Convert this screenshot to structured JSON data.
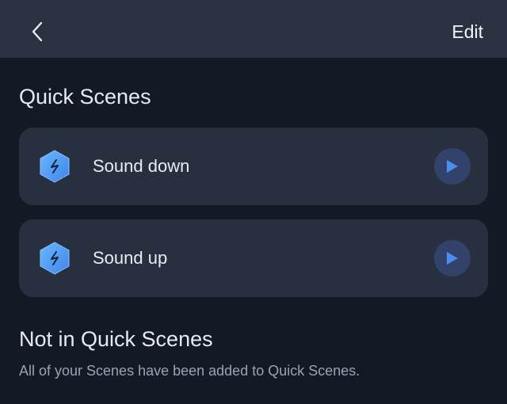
{
  "header": {
    "back_icon": "chevron-left-icon",
    "edit_label": "Edit"
  },
  "quick_scenes": {
    "title": "Quick Scenes",
    "items": [
      {
        "label": "Sound down",
        "icon": "lightning-hexagon-icon",
        "action_icon": "play-icon"
      },
      {
        "label": "Sound up",
        "icon": "lightning-hexagon-icon",
        "action_icon": "play-icon"
      }
    ]
  },
  "not_in_quick_scenes": {
    "title": "Not in Quick Scenes",
    "message": "All of your Scenes have been added to Quick Scenes."
  },
  "colors": {
    "background": "#141a25",
    "header": "#2a3140",
    "card": "#283040",
    "accent": "#4a8ff0",
    "play_button": "#33426a"
  }
}
